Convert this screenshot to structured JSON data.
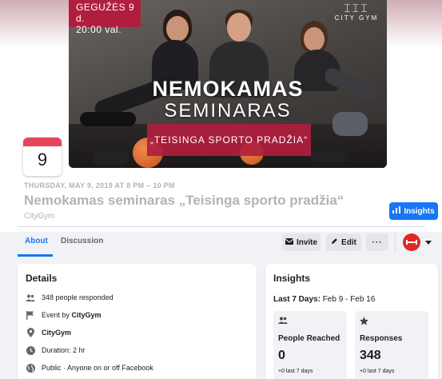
{
  "cover": {
    "date_line1": "GEGUŽĖS 9 d.",
    "date_line2": "20:00 val.",
    "brand_name": "CITY GYM",
    "headline_line1": "NEMOKAMAS",
    "headline_line2": "SEMINARAS",
    "cta": "„TEISINGA SPORTO PRADŽIA“"
  },
  "event": {
    "calendar_day": "9",
    "when": "THURSDAY, MAY 9, 2019 AT 8 PM – 10 PM",
    "title": "Nemokamas seminaras „Teisinga sporto pradžia“",
    "host": "CityGym"
  },
  "header_actions": {
    "insights_label": "Insights",
    "invite_label": "Invite",
    "edit_label": "Edit",
    "more_label": "···"
  },
  "tabs": {
    "about": "About",
    "discussion": "Discussion"
  },
  "details": {
    "heading": "Details",
    "responded": "348 people responded",
    "event_by_prefix": "Event by ",
    "event_by_name": "CityGym",
    "location": "CityGym",
    "duration": "Duration: 2 hr",
    "privacy": "Public · Anyone on or off Facebook"
  },
  "insights": {
    "heading": "Insights",
    "range_label": "Last 7 Days:",
    "range_value": " Feb 9 - Feb 16",
    "reached_label": "People Reached",
    "reached_value": "0",
    "reached_delta": "+0 last 7 days",
    "responses_label": "Responses",
    "responses_value": "348",
    "responses_delta": "+0 last 7 days"
  },
  "colors": {
    "accent": "#1877f2",
    "brand_red": "#b01e3f",
    "calendar_band": "#e4455b"
  }
}
